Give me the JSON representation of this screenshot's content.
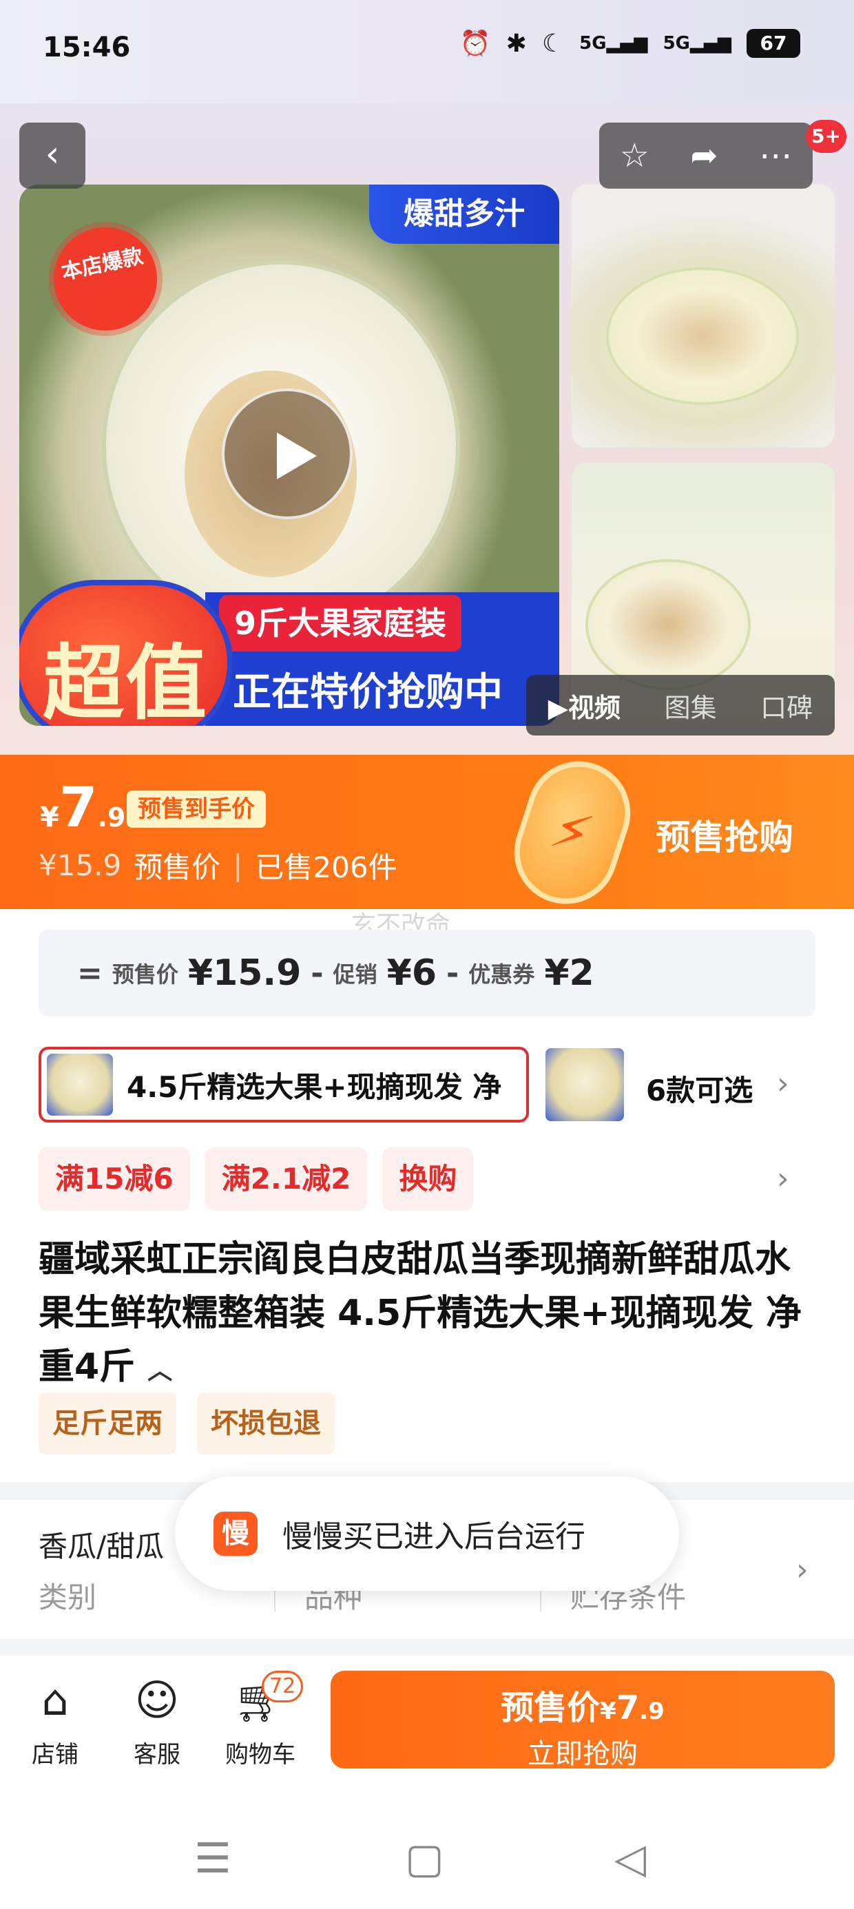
{
  "status_bar": {
    "time": "15:46",
    "signal_1": "5G",
    "signal_2": "5G",
    "battery": "67"
  },
  "header": {
    "back_icon": "chevron-left-icon",
    "favorite_icon": "star-icon",
    "share_icon": "share-icon",
    "more_icon": "more-icon",
    "message_badge": "5+"
  },
  "gallery": {
    "ribbon_top": "爆甜多汁",
    "burst_badge": "本店爆款",
    "seal_text": "超值",
    "promo_line1": "9斤大果家庭装",
    "promo_line2": "正在特价抢购中",
    "tabs": [
      "视频",
      "图集",
      "口碑"
    ],
    "active_tab": "视频"
  },
  "price": {
    "currency": "¥",
    "integer": "7",
    "decimal": ".9",
    "chip": "预售到手价",
    "original": "¥15.9",
    "original_label": "预售价",
    "sold": "已售206件",
    "cta": "预售抢购"
  },
  "watermark": "玄不改命",
  "formula": {
    "eq": "=",
    "presale_label": "预售价",
    "presale_value": "¥15.9",
    "minus1": "-",
    "promo_label": "促销",
    "promo_value": "¥6",
    "minus2": "-",
    "coupon_label": "优惠券",
    "coupon_value": "¥2"
  },
  "sku": {
    "selected_text": "4.5斤精选大果+现摘现发 净",
    "options_count": "6款可选"
  },
  "promo_tags": [
    "满15减6",
    "满2.1减2",
    "换购"
  ],
  "title": "疆域采虹正宗阎良白皮甜瓜当季现摘新鲜甜瓜水果生鲜软糯整箱装 4.5斤精选大果+现摘现发 净重4斤",
  "service_tags": [
    "足斤足两",
    "坏损包退"
  ],
  "specs": {
    "first_value": "香瓜/甜瓜",
    "labels": [
      "类别",
      "品种",
      "贮存条件"
    ]
  },
  "toast": {
    "icon_text": "慢",
    "message": "慢慢买已进入后台运行"
  },
  "bottom_bar": {
    "shop_label": "店铺",
    "service_label": "客服",
    "cart_label": "购物车",
    "cart_count": "72",
    "buy_price_label": "预售价",
    "buy_price_currency": "¥",
    "buy_price_int": "7",
    "buy_price_dec": ".9",
    "buy_action": "立即抢购"
  },
  "colors": {
    "accent": "#ff6b16",
    "promo_red": "#e62a2a",
    "brand_blue": "#1f3fd1"
  }
}
